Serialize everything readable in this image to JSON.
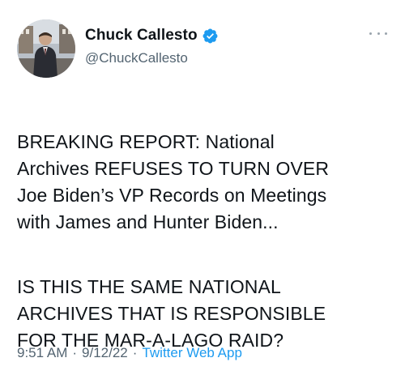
{
  "author": {
    "display_name": "Chuck Callesto",
    "handle": "@ChuckCallesto",
    "verified_icon": "verified-badge-icon",
    "verified_color": "#1d9bf0"
  },
  "tweet": {
    "paragraphs": [
      "BREAKING REPORT: National\nArchives REFUSES TO TURN OVER\nJoe Biden’s VP Records on Meetings\nwith James and Hunter Biden...",
      "IS THIS THE SAME NATIONAL\nARCHIVES THAT IS RESPONSIBLE\nFOR THE MAR-A-LAGO RAID?"
    ]
  },
  "meta": {
    "time": "9:51 AM",
    "separator": "·",
    "date": "9/12/22",
    "source": "Twitter Web App"
  },
  "icons": {
    "more": "more-options-icon"
  }
}
